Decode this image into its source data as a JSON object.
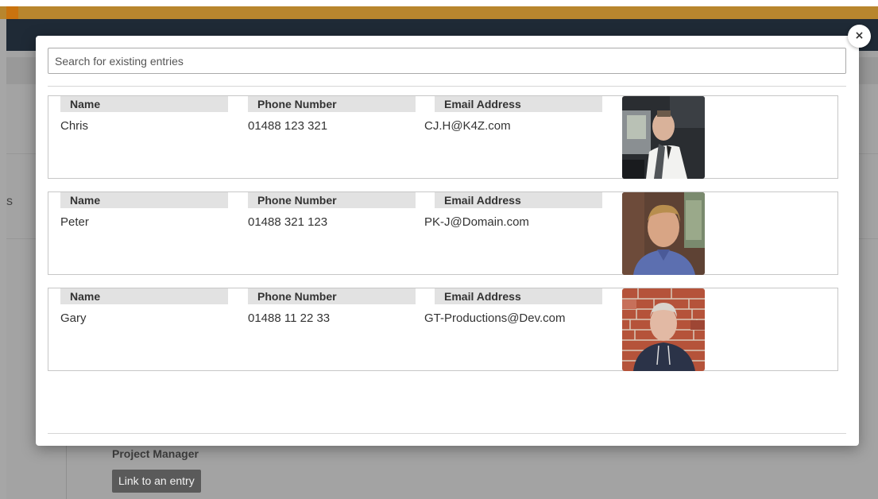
{
  "background": {
    "side_letter": "s",
    "role_label": "Project Manager",
    "link_button_label": "Link to an entry"
  },
  "modal": {
    "close_label": "×",
    "search": {
      "placeholder": "Search for existing entries",
      "value": ""
    },
    "headers": {
      "name": "Name",
      "phone": "Phone Number",
      "email": "Email Address"
    },
    "entries": [
      {
        "name": "Chris",
        "phone": "01488 123 321",
        "email": "CJ.H@K4Z.com",
        "photo_icon": "person-in-car-photo"
      },
      {
        "name": "Peter",
        "phone": "01488 321 123",
        "email": "PK-J@Domain.com",
        "photo_icon": "person-portrait-photo"
      },
      {
        "name": "Gary",
        "phone": "01488 11 22 33",
        "email": "GT-Productions@Dev.com",
        "photo_icon": "person-brick-wall-photo"
      }
    ]
  },
  "colors": {
    "accent_bar": "#b8862e",
    "navbar": "#1f2a36",
    "header_cell": "#e2e2e2",
    "overlay": "#a6a6a6"
  }
}
